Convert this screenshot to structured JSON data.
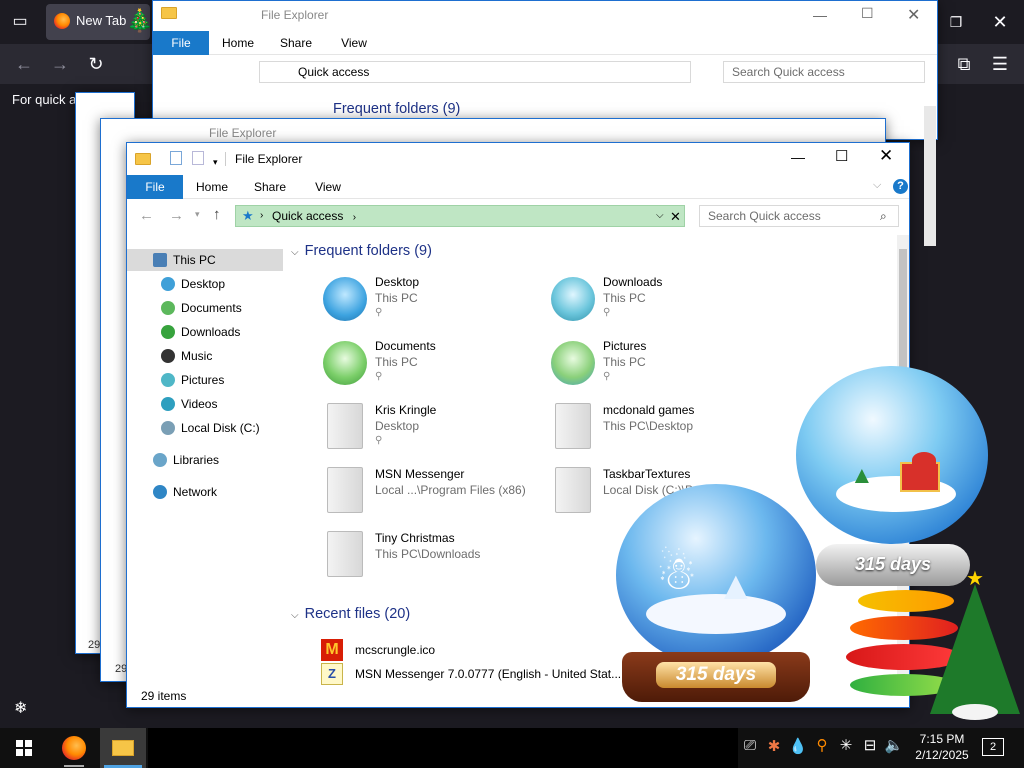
{
  "browser": {
    "tab_label": "New Tab",
    "hint_text": "For quick access"
  },
  "explorer": {
    "title": "File Explorer",
    "ribbon_tabs": [
      "File",
      "Home",
      "Share",
      "View"
    ],
    "address": {
      "location": "Quick access"
    },
    "search_placeholder": "Search Quick access",
    "nav": [
      {
        "label": "This PC",
        "icon": "monitor-icon",
        "selected": true
      },
      {
        "label": "Desktop",
        "icon": "desktop-icon"
      },
      {
        "label": "Documents",
        "icon": "documents-icon"
      },
      {
        "label": "Downloads",
        "icon": "downloads-icon"
      },
      {
        "label": "Music",
        "icon": "music-icon"
      },
      {
        "label": "Pictures",
        "icon": "pictures-icon"
      },
      {
        "label": "Videos",
        "icon": "videos-icon"
      },
      {
        "label": "Local Disk (C:)",
        "icon": "disk-icon"
      },
      {
        "label": "Libraries",
        "icon": "libraries-icon"
      },
      {
        "label": "Network",
        "icon": "network-icon"
      }
    ],
    "frequent_header": "Frequent folders (9)",
    "frequent": [
      {
        "name": "Desktop",
        "location": "This PC"
      },
      {
        "name": "Downloads",
        "location": "This PC"
      },
      {
        "name": "Documents",
        "location": "This PC"
      },
      {
        "name": "Pictures",
        "location": "This PC"
      },
      {
        "name": "Kris Kringle",
        "location": "Desktop"
      },
      {
        "name": "mcdonald games",
        "location": "This PC\\Desktop"
      },
      {
        "name": "MSN Messenger",
        "location": "Local ...\\Program Files (x86)"
      },
      {
        "name": "TaskbarTextures",
        "location": "Local Disk (C:)\\Program..."
      },
      {
        "name": "Tiny Christmas",
        "location": "This PC\\Downloads"
      }
    ],
    "recent_header": "Recent files (20)",
    "recent": [
      {
        "name": "mcscrungle.ico"
      },
      {
        "name": "MSN Messenger 7.0.0777 (English - United Stat..."
      }
    ],
    "status": "29 items",
    "bg_status": "29"
  },
  "widgets": {
    "globe_small_days": "315 days",
    "globe_big_days": "315 days"
  },
  "taskbar": {
    "time": "7:15 PM",
    "date": "2/12/2025",
    "notification_count": "2"
  },
  "colors": {
    "accent": "#1979ca",
    "header_blue": "#1e3287",
    "address_highlight": "#bfe6c4"
  }
}
